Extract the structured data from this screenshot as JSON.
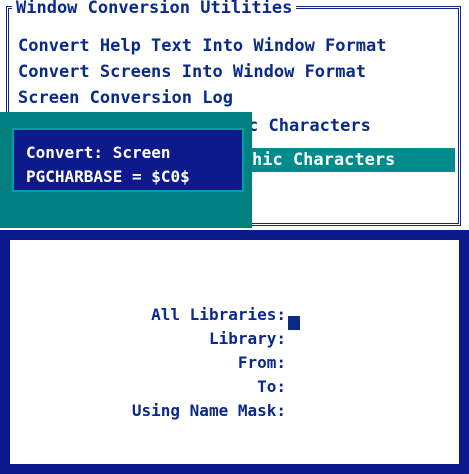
{
  "menu": {
    "title": "Window Conversion Utilities",
    "items": [
      {
        "label": "Convert Help Text Into Window Format"
      },
      {
        "label": "Convert Screens Into Window Format"
      },
      {
        "label": "Screen Conversion Log"
      },
      {
        "label": "c Characters"
      },
      {
        "label": "hic Characters",
        "selected": true
      }
    ]
  },
  "popup": {
    "lines": [
      "Convert: Screen",
      "PGCHARBASE = $C0$"
    ]
  },
  "form": {
    "fields": [
      {
        "label": "All Libraries:",
        "value": "",
        "focused": true
      },
      {
        "label": "Library:",
        "value": ""
      },
      {
        "label": "From:",
        "value": ""
      },
      {
        "label": "To:",
        "value": ""
      },
      {
        "label": "Using Name Mask:",
        "value": ""
      }
    ]
  },
  "colors": {
    "navy": "#0d1a8c",
    "teal": "#008080",
    "highlight": "#008c8c",
    "text": "#0a2a8a"
  }
}
